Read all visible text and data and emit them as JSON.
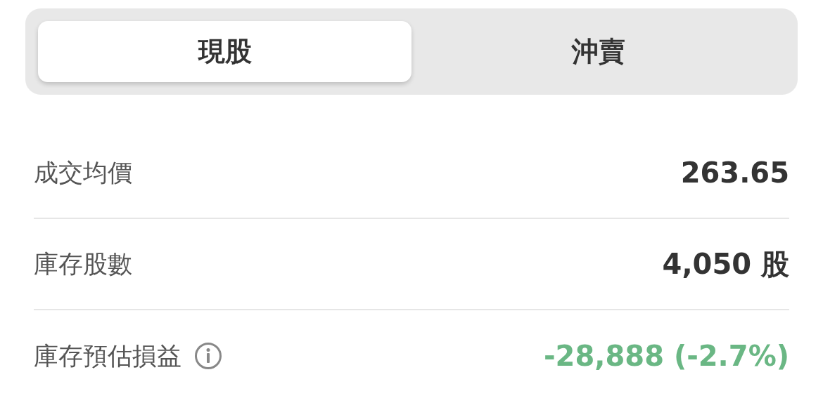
{
  "tabs": [
    {
      "label": "現股",
      "selected": true
    },
    {
      "label": "沖賣",
      "selected": false
    }
  ],
  "rows": [
    {
      "label": "成交均價",
      "value": "263.65",
      "color": "#333333",
      "info": false
    },
    {
      "label": "庫存股數",
      "value": "4,050 股",
      "color": "#333333",
      "info": false
    },
    {
      "label": "庫存預估損益",
      "value": "-28,888 (-2.7%)",
      "color": "#6ab784",
      "info": true
    }
  ]
}
